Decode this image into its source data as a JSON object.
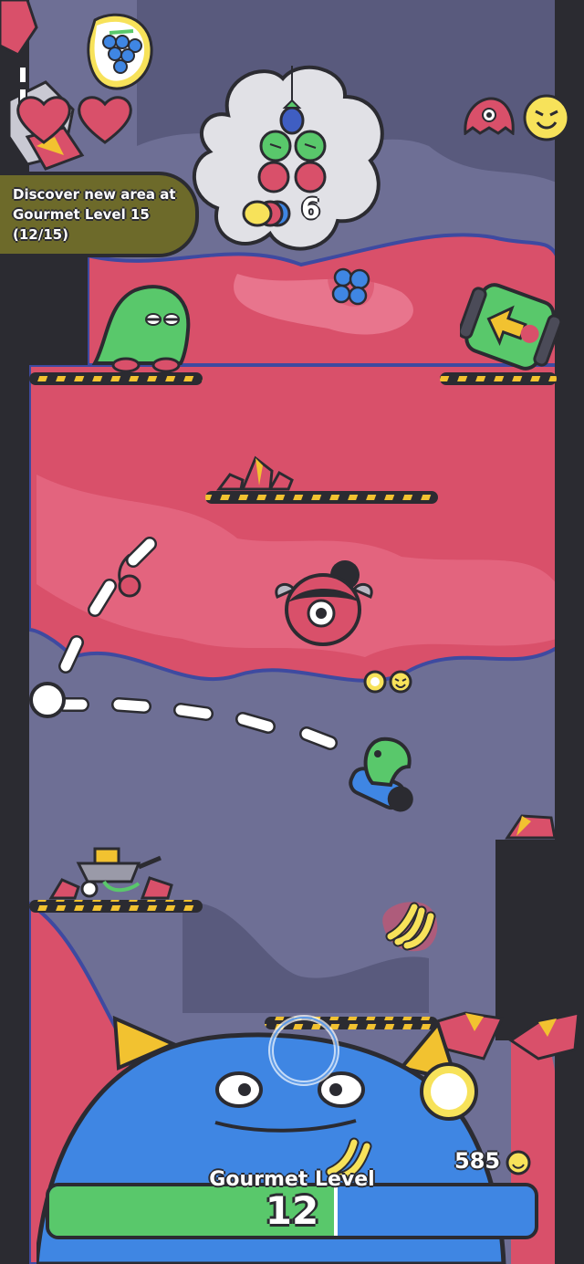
{
  "hud": {
    "lives": 2,
    "quest_text": "Discover new area at Gourmet Level 15 (12/15)",
    "craving_count": "6",
    "coin_count": "585",
    "gourmet_level_label": "Gourmet Level",
    "gourmet_level_value": "12",
    "gourmet_level_progress": 0.59
  },
  "colors": {
    "cave_pink": "#d9506a",
    "cave_purple": "#6e6f95",
    "wall_dark": "#2b2b31",
    "monster_blue": "#3f86e3",
    "level_green": "#59c86b",
    "quest_olive": "#6d6a2a",
    "hazard_yellow": "#f2c230"
  },
  "icons": [
    "pause-icon",
    "grape-icon",
    "heart-icon",
    "red-ghost-icon",
    "smiley-coin-icon",
    "eggplant-icon",
    "kiwi-icon",
    "cherry-icon",
    "lemon-icon",
    "blueberry-icon",
    "barrel-cannon-icon",
    "banana-icon",
    "wheelbarrow-icon",
    "coin-icon",
    "crystal-icon"
  ]
}
